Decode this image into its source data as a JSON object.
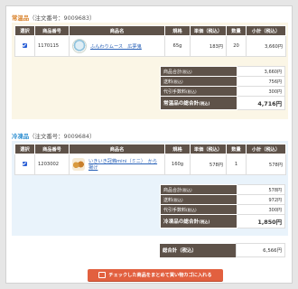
{
  "sections": [
    {
      "kind": "常温品",
      "order_prefix": "（注文番号：",
      "order_no": "9009683",
      "order_suffix": "）",
      "headers": [
        "選択",
        "商品番号",
        "商品名",
        "規格",
        "単価（税込）",
        "数量",
        "小計（税込）"
      ],
      "row": {
        "code": "1170115",
        "name": "ふんわりムース　広夢鬼",
        "spec": "65g",
        "unit_price": "183円",
        "qty": "20",
        "subtotal": "3,660円"
      },
      "summary": [
        {
          "label": "商品合計",
          "note": "(税込)",
          "value": "3,660円"
        },
        {
          "label": "送料",
          "note": "(税込)",
          "value": "756円"
        },
        {
          "label": "代引手数料",
          "note": "(税込)",
          "value": "300円"
        }
      ],
      "total": {
        "label": "常温品の総合計",
        "note": "(税込)",
        "value": "4,716円"
      }
    },
    {
      "kind": "冷凍品",
      "order_prefix": "（注文番号：",
      "order_no": "9009684",
      "order_suffix": "）",
      "headers": [
        "選択",
        "商品番号",
        "商品名",
        "規格",
        "単価（税込）",
        "数量",
        "小計（税込）"
      ],
      "row": {
        "code": "1203002",
        "name": "いきいき冠鶏mini（ミニ）　から揚げ",
        "spec": "160g",
        "unit_price": "578円",
        "qty": "1",
        "subtotal": "578円"
      },
      "summary": [
        {
          "label": "商品合計",
          "note": "(税込)",
          "value": "578円"
        },
        {
          "label": "送料",
          "note": "(税込)",
          "value": "972円"
        },
        {
          "label": "代引手数料",
          "note": "(税込)",
          "value": "300円"
        }
      ],
      "total": {
        "label": "冷凍品の総合計",
        "note": "(税込)",
        "value": "1,850円"
      }
    }
  ],
  "grand_total": {
    "label": "総合計（税込）",
    "value": "6,566円"
  },
  "cart_button": {
    "label": "チェックした商品をまとめて買い物カゴに入れる"
  },
  "colors": {
    "header_bg": "#5e5249",
    "normal_accent": "#d9822b",
    "frozen_accent": "#2e8fd1",
    "button": "#e2603f"
  },
  "icons": {
    "checkbox": "checked-checkbox-icon",
    "cart": "cart-icon"
  }
}
